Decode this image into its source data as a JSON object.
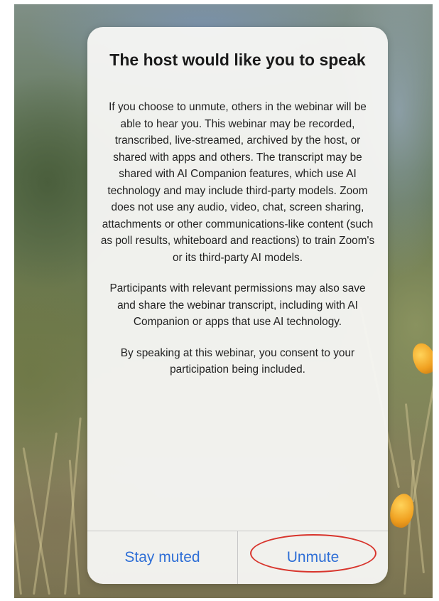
{
  "dialog": {
    "title": "The host would like you to speak",
    "paragraphs": [
      "If you choose to unmute, others in the webinar will be able to hear you. This webinar may be recorded, transcribed, live-streamed, archived by the host, or shared with apps and others. The transcript may be shared with AI Companion features, which use AI technology and may include third-party models. Zoom does not use any audio, video, chat, screen sharing, attachments or other communications-like content (such as poll results, whiteboard and reactions) to train Zoom's or its third-party AI models.",
      "Participants with relevant permissions may also save and share the webinar transcript, including with AI Companion or apps that use AI technology.",
      "By speaking at this webinar, you consent to your participation being included."
    ],
    "buttons": {
      "stay_muted": "Stay muted",
      "unmute": "Unmute"
    }
  },
  "colors": {
    "button_text": "#2f6fd6",
    "annotation_ring": "#d8342c"
  }
}
